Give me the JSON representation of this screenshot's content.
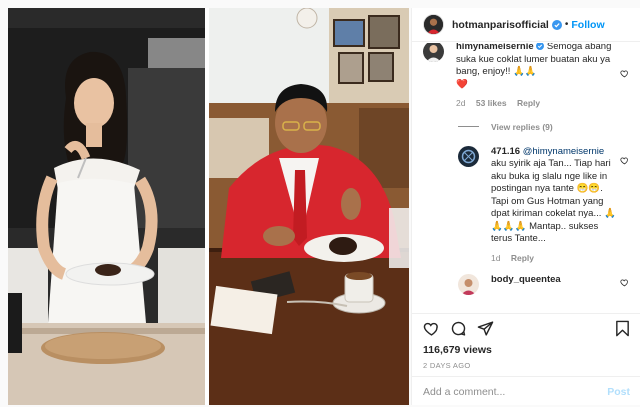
{
  "header": {
    "username": "hotmanparisofficial",
    "verified": true,
    "separator": "•",
    "follow_label": "Follow",
    "accent_color": "#0095f6"
  },
  "comments": [
    {
      "user": "himynameisernie",
      "verified": true,
      "text": "Semoga abang suka kue coklat lumer buatan aku ya bang, enjoy!! 🙏🙏",
      "extra": "❤️",
      "time": "2d",
      "likes": "53 likes",
      "reply": "Reply",
      "view_replies": "View replies (9)"
    },
    {
      "user": "471.16",
      "mention": "@himynameisernie",
      "text": "aku syirik aja Tan... Tiap hari aku buka ig slalu nge like in postingan nya tante 😁😁. Tapi om Gus Hotman yang dpat kiriman cokelat nya... 🙏🙏🙏🙏 Mantap.. sukses terus Tante...",
      "time": "1d",
      "reply": "Reply"
    },
    {
      "user": "body_queentea",
      "text": ""
    }
  ],
  "actions": {
    "like_icon": "heart-icon",
    "comment_icon": "comment-icon",
    "share_icon": "share-icon",
    "save_icon": "bookmark-icon"
  },
  "stats": {
    "views": "116,679 views",
    "date": "2 DAYS AGO"
  },
  "comment_box": {
    "placeholder": "Add a comment...",
    "post_label": "Post"
  }
}
